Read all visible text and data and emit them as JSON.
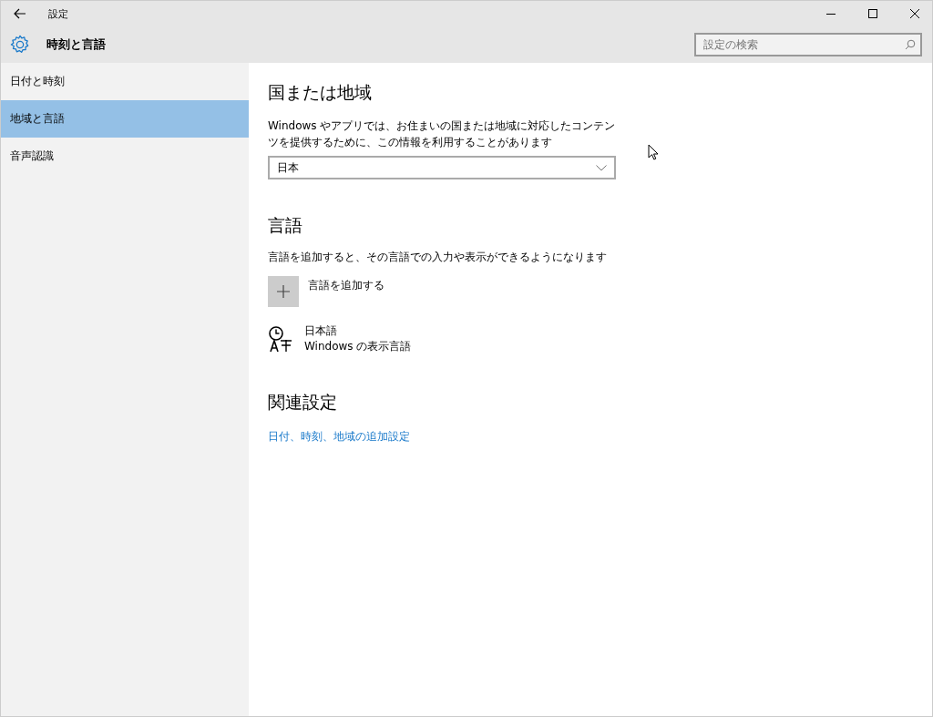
{
  "window": {
    "title": "設定"
  },
  "header": {
    "title": "時刻と言語",
    "search": {
      "placeholder": "設定の検索"
    }
  },
  "sidebar": {
    "items": [
      {
        "label": "日付と時刻",
        "selected": false
      },
      {
        "label": "地域と言語",
        "selected": true
      },
      {
        "label": "音声認識",
        "selected": false
      }
    ]
  },
  "region": {
    "heading": "国または地域",
    "description": "Windows やアプリでは、お住まいの国または地域に対応したコンテンツを提供するために、この情報を利用することがあります",
    "dropdown": {
      "value": "日本"
    }
  },
  "language": {
    "heading": "言語",
    "description": "言語を追加すると、その言語での入力や表示ができるようになります",
    "add_button": "言語を追加する",
    "languages": [
      {
        "name": "日本語",
        "note": "Windows の表示言語"
      }
    ]
  },
  "related": {
    "heading": "関連設定",
    "links": [
      "日付、時刻、地域の追加設定"
    ]
  }
}
